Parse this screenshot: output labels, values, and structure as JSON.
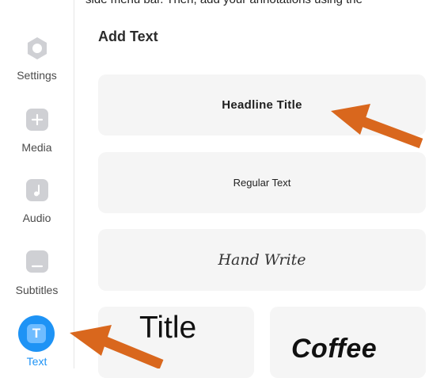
{
  "caption": "side menu bar. Then, add your annotations using the",
  "sidebar": {
    "items": [
      {
        "label": "Settings",
        "icon": "hexagon-settings-icon"
      },
      {
        "label": "Media",
        "icon": "plus-icon"
      },
      {
        "label": "Audio",
        "icon": "music-note-icon"
      },
      {
        "label": "Subtitles",
        "icon": "subtitles-icon"
      },
      {
        "label": "Text",
        "icon": "text-T-icon",
        "active": true
      }
    ],
    "active_color": "#1e93f5",
    "text_icon_glyph": "T"
  },
  "main": {
    "title": "Add Text",
    "presets": [
      {
        "label": "Headline Title"
      },
      {
        "label": "Regular Text"
      },
      {
        "label": "Hand Write"
      },
      {
        "label": "Title"
      },
      {
        "label": "Coffee"
      }
    ]
  },
  "annotation_color": "#d9671d"
}
